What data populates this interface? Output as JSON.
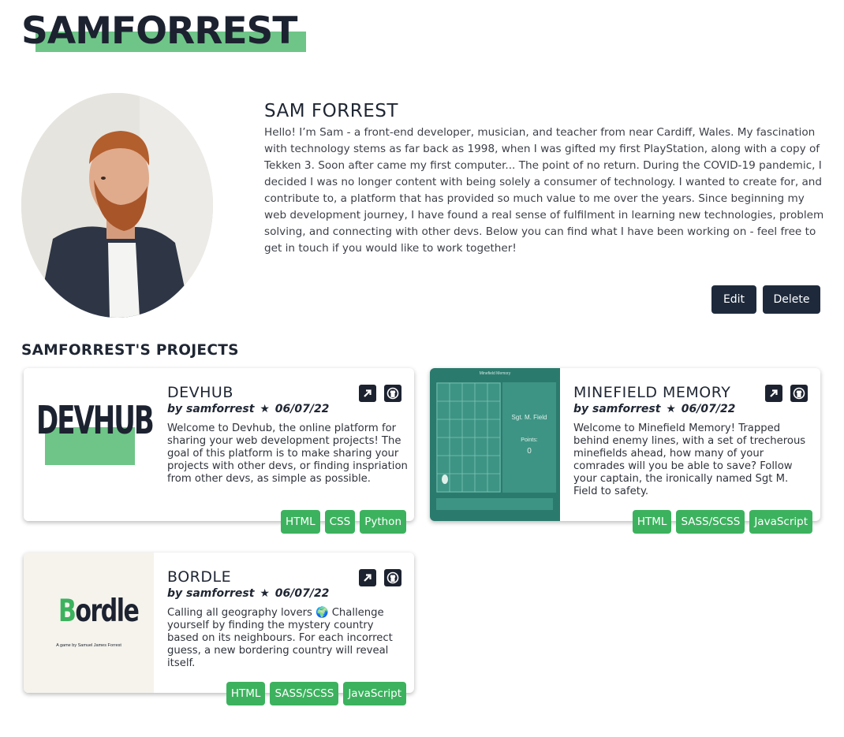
{
  "site": {
    "title": "SAMFORREST"
  },
  "profile": {
    "name": "SAM FORREST",
    "bio": "Hello! I’m Sam - a front-end developer, musician, and teacher from near Cardiff, Wales. My fascination with technology stems as far back as 1998, when I was gifted my first PlayStation, along with a copy of Tekken 3. Soon after came my first computer... The point of no return. During the COVID-19 pandemic, I decided I was no longer content with being solely a consumer of technology. I wanted to create for, and contribute to, a platform that has provided so much value to me over the years. Since beginning my web development journey, I have found a real sense of fulfilment in learning new technologies, problem solving, and connecting with other devs. Below you can find what I have been working on - feel free to get in touch if you would like to work together!",
    "edit_label": "Edit",
    "delete_label": "Delete"
  },
  "projects_heading": "SAMFORREST'S PROJECTS",
  "projects": [
    {
      "title": "DEVHUB",
      "author": "by samforrest",
      "date": "06/07/22",
      "description": "Welcome to Devhub, the online platform for sharing your web development projects! The goal of this platform is to make sharing your projects with other devs, or finding inspriation from other devs, as simple as possible.",
      "tags": [
        "HTML",
        "CSS",
        "Python"
      ],
      "thumb_text": "DEVHUB"
    },
    {
      "title": "MINEFIELD MEMORY",
      "author": "by samforrest",
      "date": "06/07/22",
      "description": "Welcome to Minefield Memory! Trapped behind enemy lines, with a set of trecherous minefields ahead, how many of your comrades will you be able to save? Follow your captain, the ironically named Sgt M. Field to safety.",
      "tags": [
        "HTML",
        "SASS/SCSS",
        "JavaScript"
      ],
      "thumb_title": "Minefield Memory",
      "thumb_name": "Sgt. M. Field",
      "thumb_points_label": "Points:",
      "thumb_points": "0"
    },
    {
      "title": "BORDLE",
      "author": "by samforrest",
      "date": "06/07/22",
      "description": "Calling all geography lovers 🌍 Challenge yourself by finding the mystery country based on its neighbours. For each incorrect guess, a new bordering country will reveal itself.",
      "tags": [
        "HTML",
        "SASS/SCSS",
        "JavaScript"
      ],
      "thumb_logo_first": "B",
      "thumb_logo_rest": "ordle",
      "thumb_caption": "A game by Samuel James Forrest"
    }
  ],
  "colors": {
    "accent_green": "#3cb25e",
    "highlight_green": "#6ec587",
    "navy": "#1e2a3c",
    "minefield_teal": "#2b7a6e"
  },
  "icons": [
    "external-link-icon",
    "github-icon",
    "star-icon"
  ]
}
